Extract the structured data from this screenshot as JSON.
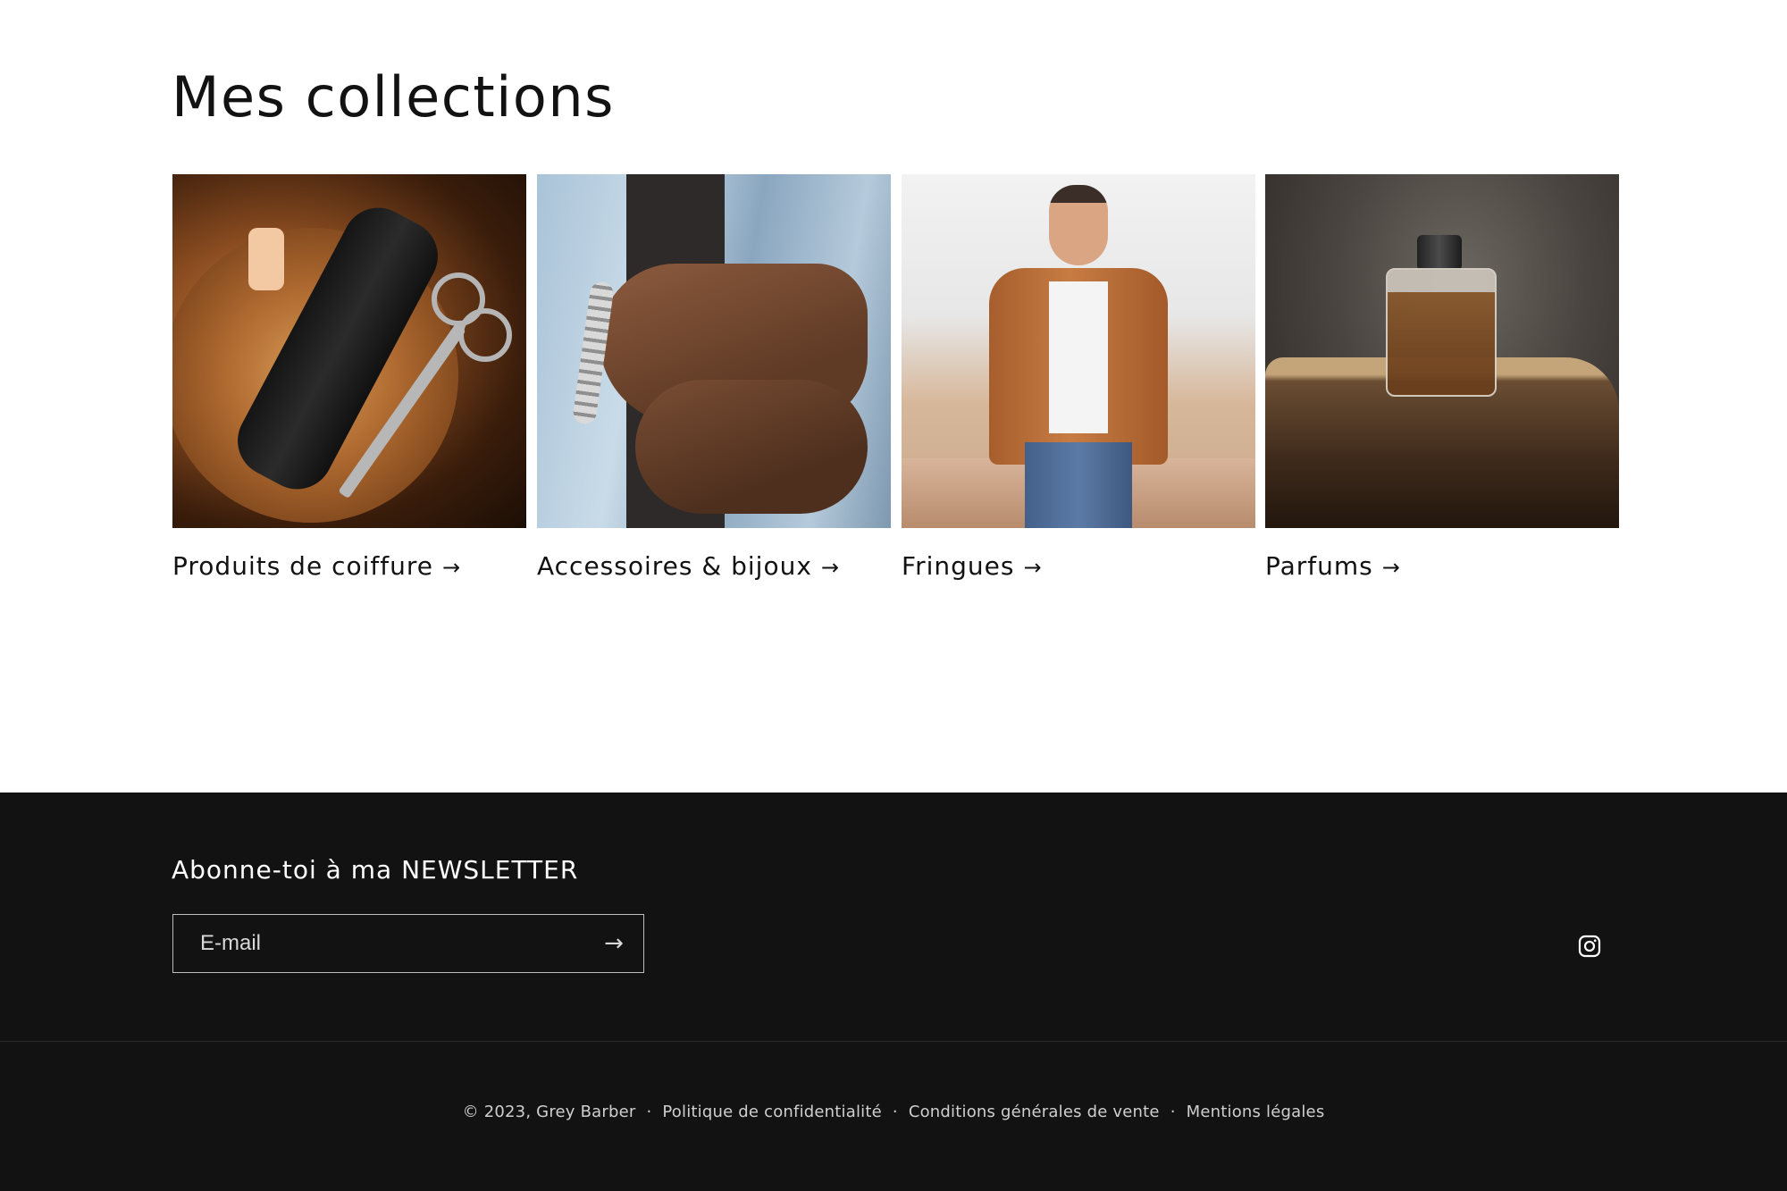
{
  "collections": {
    "title": "Mes collections",
    "items": [
      {
        "label": "Produits de coiffure",
        "arrow": "→",
        "image": "hair-clipper-photo"
      },
      {
        "label": "Accessoires & bijoux",
        "arrow": "→",
        "image": "rings-bracelet-photo"
      },
      {
        "label": "Fringues",
        "arrow": "→",
        "image": "man-jacket-photo"
      },
      {
        "label": "Parfums",
        "arrow": "→",
        "image": "perfume-bottle-photo"
      }
    ]
  },
  "footer": {
    "newsletter_title": "Abonne-toi à ma NEWSLETTER",
    "email_placeholder": "E-mail",
    "submit_icon": "→",
    "social_icon": "instagram-icon",
    "copyright": "© 2023, Grey Barber",
    "links": [
      "Politique de confidentialité",
      "Conditions générales de vente",
      "Mentions légales"
    ],
    "separator": "·",
    "background_color": "#121212"
  }
}
